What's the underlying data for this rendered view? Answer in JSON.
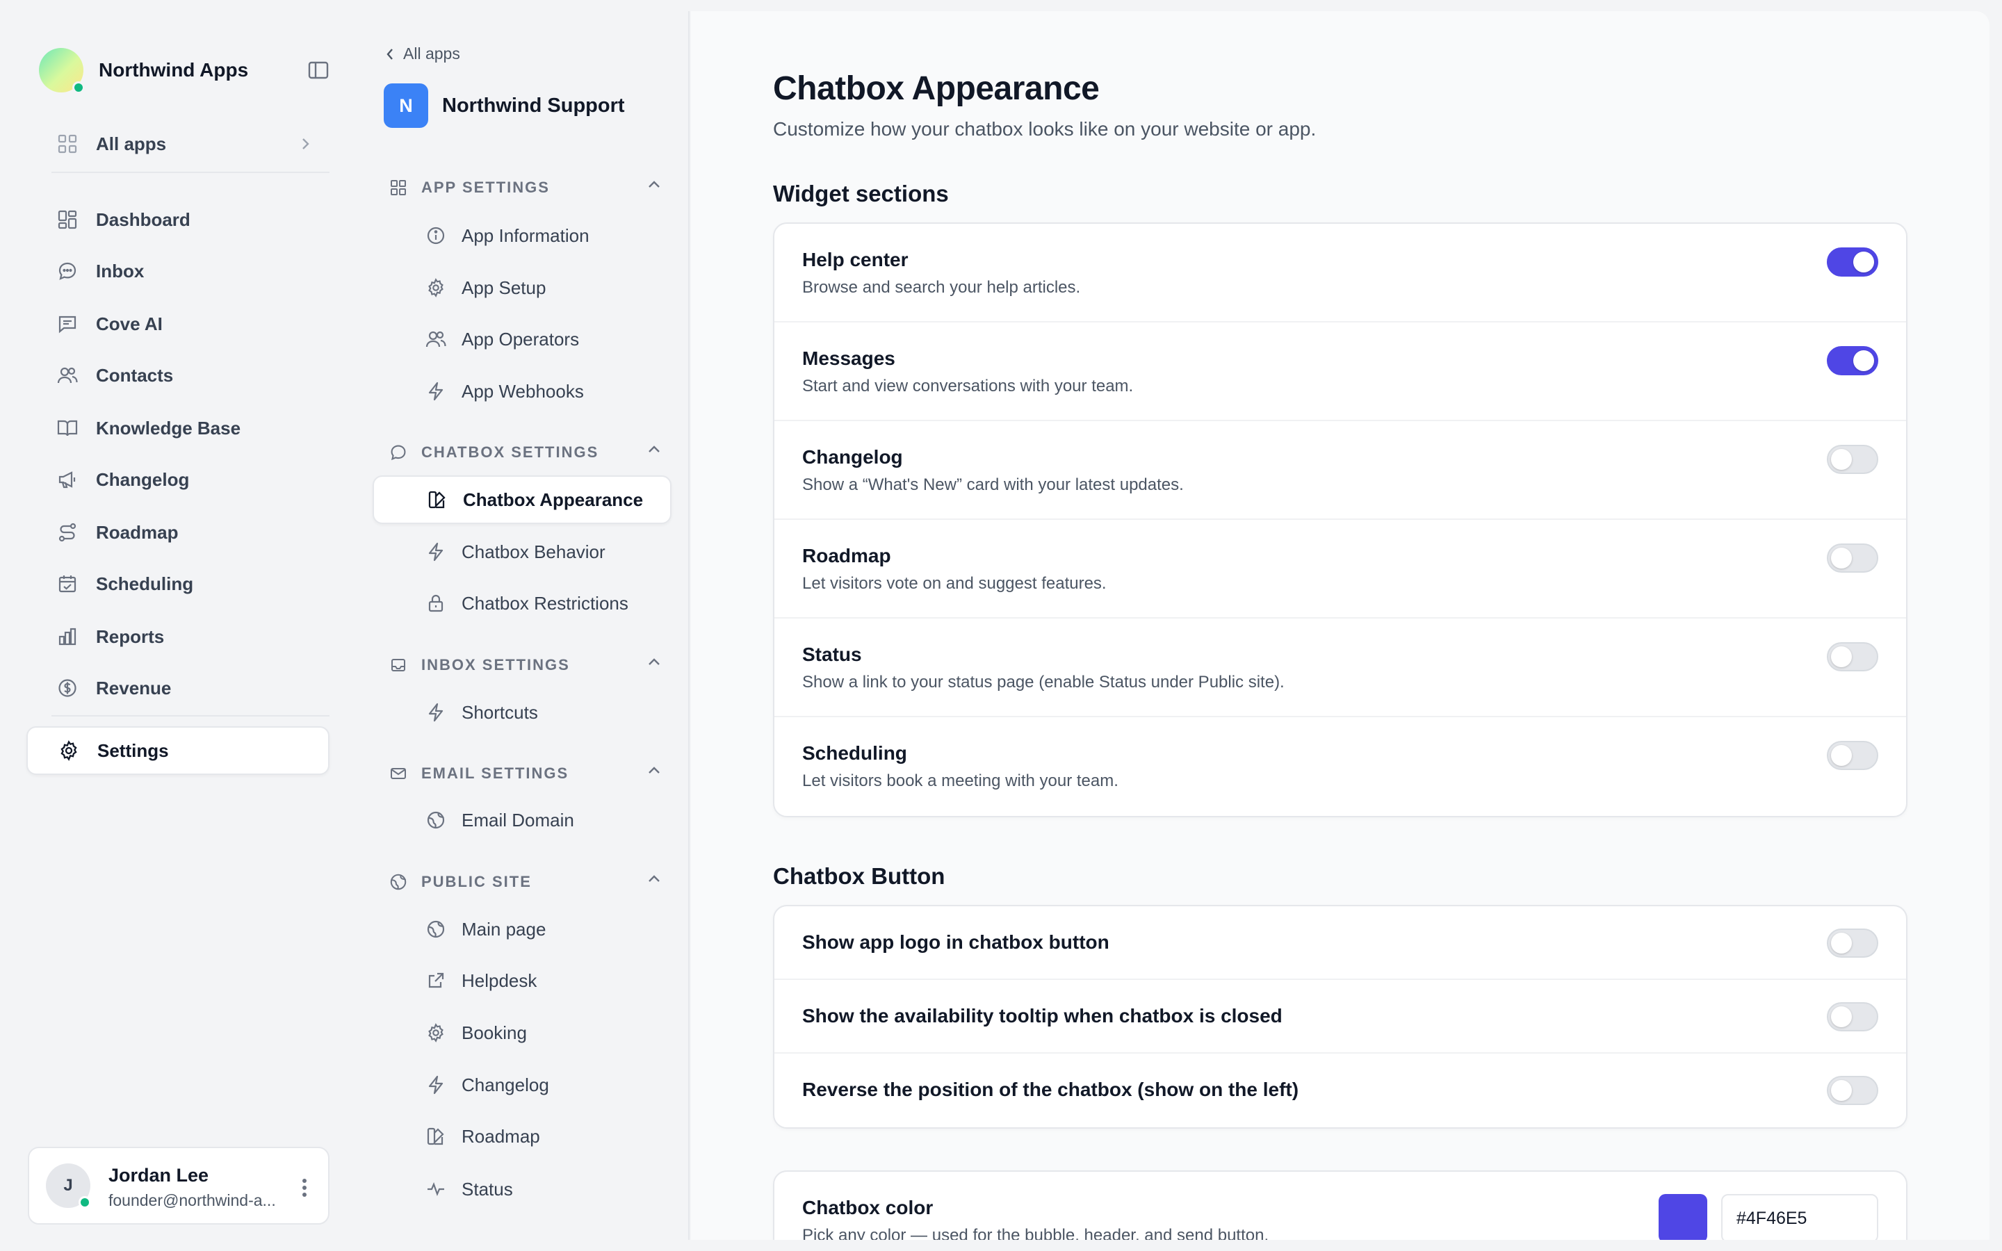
{
  "brand": {
    "name": "Northwind Apps"
  },
  "nav": {
    "all_apps": "All apps",
    "items": [
      {
        "label": "Dashboard"
      },
      {
        "label": "Inbox"
      },
      {
        "label": "Cove AI"
      },
      {
        "label": "Contacts"
      },
      {
        "label": "Knowledge Base"
      },
      {
        "label": "Changelog"
      },
      {
        "label": "Roadmap"
      },
      {
        "label": "Scheduling"
      },
      {
        "label": "Reports"
      },
      {
        "label": "Revenue"
      }
    ],
    "settings": "Settings"
  },
  "user": {
    "initial": "J",
    "name": "Jordan Lee",
    "email": "founder@northwind-a..."
  },
  "panel": {
    "back": "All apps",
    "app_initial": "N",
    "app_name": "Northwind Support",
    "sections": [
      {
        "title": "APP SETTINGS",
        "items": [
          "App Information",
          "App Setup",
          "App Operators",
          "App Webhooks"
        ]
      },
      {
        "title": "CHATBOX SETTINGS",
        "items": [
          "Chatbox Appearance",
          "Chatbox Behavior",
          "Chatbox Restrictions"
        ]
      },
      {
        "title": "INBOX SETTINGS",
        "items": [
          "Shortcuts"
        ]
      },
      {
        "title": "EMAIL SETTINGS",
        "items": [
          "Email Domain"
        ]
      },
      {
        "title": "PUBLIC SITE",
        "items": [
          "Main page",
          "Helpdesk",
          "Booking",
          "Changelog",
          "Roadmap",
          "Status"
        ]
      }
    ]
  },
  "main": {
    "title": "Chatbox Appearance",
    "subtitle": "Customize how your chatbox looks like on your website or app.",
    "widget_title": "Widget sections",
    "widget_rows": [
      {
        "title": "Help center",
        "desc": "Browse and search your help articles.",
        "on": true
      },
      {
        "title": "Messages",
        "desc": "Start and view conversations with your team.",
        "on": true
      },
      {
        "title": "Changelog",
        "desc": "Show a “What's New” card with your latest updates.",
        "on": false
      },
      {
        "title": "Roadmap",
        "desc": "Let visitors vote on and suggest features.",
        "on": false
      },
      {
        "title": "Status",
        "desc": "Show a link to your status page (enable Status under Public site).",
        "on": false
      },
      {
        "title": "Scheduling",
        "desc": "Let visitors book a meeting with your team.",
        "on": false
      }
    ],
    "button_title": "Chatbox Button",
    "button_rows": [
      {
        "title": "Show app logo in chatbox button",
        "on": false
      },
      {
        "title": "Show the availability tooltip when chatbox is closed",
        "on": false
      },
      {
        "title": "Reverse the position of the chatbox (show on the left)",
        "on": false
      }
    ],
    "color": {
      "title": "Chatbox color",
      "desc": "Pick any color — used for the bubble, header, and send button.",
      "value": "#4F46E5",
      "swatch": "#4F46E5"
    }
  }
}
